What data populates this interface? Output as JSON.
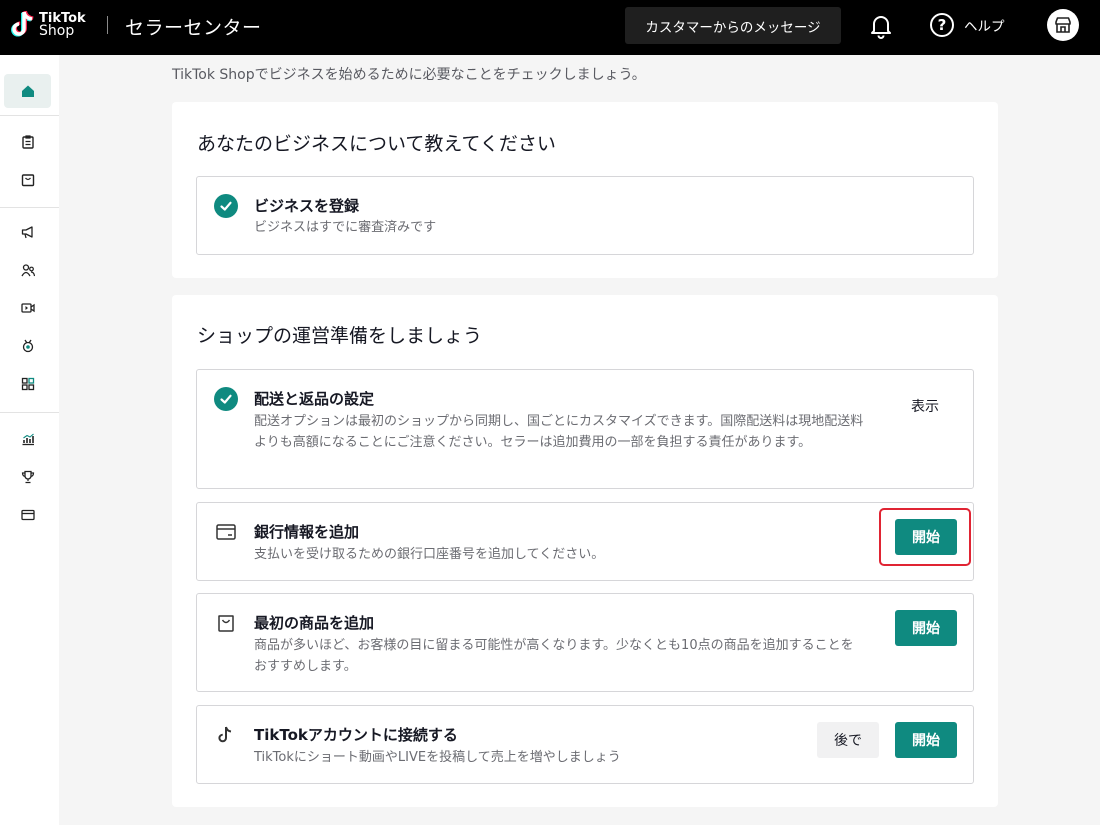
{
  "header": {
    "logo_line1": "TikTok",
    "logo_line2": "Shop",
    "title": "セラーセンター",
    "message_button": "カスタマーからのメッセージ",
    "help_label": "ヘルプ"
  },
  "sidebar": {
    "items": [
      "home-icon",
      "clipboard-icon",
      "bag-icon",
      "megaphone-icon",
      "users-icon",
      "video-icon",
      "badge-icon",
      "grid-icon",
      "chart-icon",
      "trophy-icon",
      "card-icon"
    ],
    "active": "home-icon"
  },
  "intro": "TikTok Shopでビジネスを始めるために必要なことをチェックしましょう。",
  "business_section": {
    "title": "あなたのビジネスについて教えてください",
    "task": {
      "title": "ビジネスを登録",
      "description": "ビジネスはすでに審査済みです",
      "status": "completed"
    }
  },
  "shop_section": {
    "title": "ショップの運営準備をしましょう",
    "tasks": [
      {
        "title": "配送と返品の設定",
        "description": "配送オプションは最初のショップから同期し、国ごとにカスタマイズできます。国際配送料は現地配送料よりも高額になることにご注意ください。セラーは追加費用の一部を負担する責任があります。",
        "action": "表示",
        "status": "completed"
      },
      {
        "title": "銀行情報を追加",
        "description": "支払いを受け取るための銀行口座番号を追加してください。",
        "action": "開始",
        "icon": "bank-card-icon"
      },
      {
        "title": "最初の商品を追加",
        "description": "商品が多いほど、お客様の目に留まる可能性が高くなります。少なくとも10点の商品を追加することをおすすめします。",
        "action": "開始",
        "icon": "shopping-bag-icon"
      },
      {
        "title": "TikTokアカウントに接続する",
        "description": "TikTokにショート動画やLIVEを投稿して売上を増やしましょう",
        "later": "後で",
        "action": "開始",
        "icon": "tiktok-icon"
      }
    ]
  },
  "colors": {
    "accent": "#0f8a80",
    "highlight": "#e02433",
    "topbar": "#000000"
  }
}
